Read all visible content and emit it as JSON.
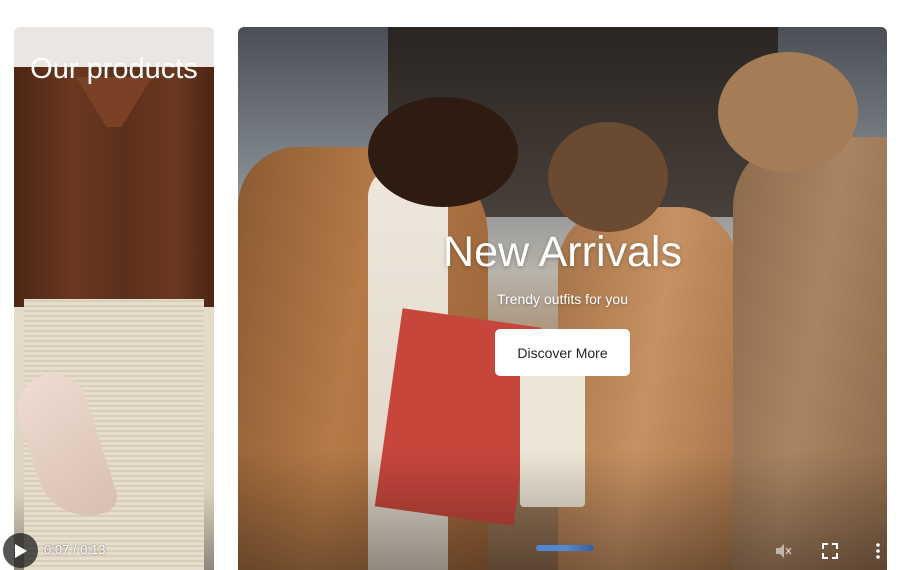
{
  "left_tile": {
    "title": "Our products"
  },
  "hero": {
    "title": "New Arrivals",
    "subtitle": "Trendy outfits for you",
    "button_label": "Discover More"
  },
  "video_controls": {
    "time": "0:07 / 0:13",
    "progress_fraction": 0.54,
    "icons": [
      "play-icon",
      "mute-icon",
      "fullscreen-icon",
      "more-options-icon"
    ]
  }
}
